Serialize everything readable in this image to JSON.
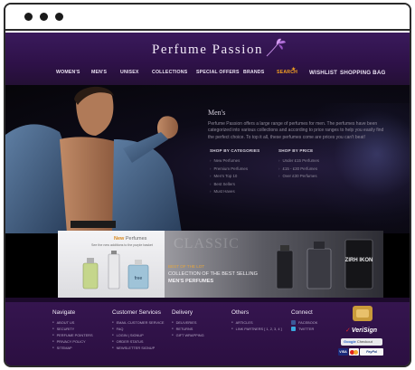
{
  "site": {
    "logo_text": "Perfume Passion"
  },
  "nav": {
    "items": [
      "WOMEN'S",
      "MEN'S",
      "UNISEX",
      "COLLECTIONS",
      "SPECIAL OFFERS",
      "BRANDS",
      "SEARCH",
      "WISHLIST",
      "SHOPPING BAG"
    ]
  },
  "intro": {
    "title": "Men's",
    "text": "Perfume Passion offers a large range of perfumes for men. The perfumes have been categorized into various collections and according to price ranges to help you easily find the perfect choice. To top it all, these perfumes come are prices you can't beat!"
  },
  "shop_by_categories": {
    "heading": "SHOP BY CATEGORIES",
    "items": [
      "New Perfumes",
      "Premium Perfumes",
      "Men's Top 10",
      "Best Sellers",
      "Must Haves"
    ]
  },
  "shop_by_price": {
    "heading": "SHOP BY PRICE",
    "items": [
      "Under £15 Perfumes",
      "£15 - £30 Perfumes",
      "Over £30 Perfumes"
    ]
  },
  "banner": {
    "new_prefix": "New",
    "new_suffix": "Perfumes",
    "new_sub": "See the new additions to the purple basket",
    "bottle_label": "free",
    "classic": "CLASSIC",
    "best_line1": "BEST OF THE LOT",
    "best_line2": "COLLECTION OF THE BEST SELLING",
    "best_line3": "MEN'S PERFUMES",
    "zirh_label": "ZIRH IKON"
  },
  "footer": {
    "navigate": {
      "heading": "Navigate",
      "items": [
        "ABOUT US",
        "SECURITY",
        "PERFUME POINTERS",
        "PRIVACY POLICY",
        "SITEMAP"
      ]
    },
    "customer_services": {
      "heading": "Customer Services",
      "items": [
        "EMAIL CUSTOMER SERVICE",
        "FAQ",
        "LOGIN | SIGNUP",
        "ORDER STATUS",
        "NEWSLETTER SIGNUP"
      ]
    },
    "delivery": {
      "heading": "Delivery",
      "items": [
        "DELIVERIES",
        "RETURNS",
        "GIFT WRAPPING"
      ]
    },
    "others": {
      "heading": "Others",
      "items": [
        "ARTICLES",
        "LINK PARTNERS [ 1, 2, 3, 4 ]"
      ]
    },
    "connect": {
      "heading": "Connect",
      "items": [
        "FACEBOOK",
        "TWITTER"
      ]
    },
    "verisign": "VeriSign",
    "google_checkout_prefix": "Google",
    "google_checkout_suffix": "Checkout",
    "visa": "VISA",
    "paypal": "PayPal"
  },
  "colors": {
    "header_purple": "#2e1148",
    "footer_purple": "#35154f",
    "accent_orange": "#e6a63c"
  }
}
